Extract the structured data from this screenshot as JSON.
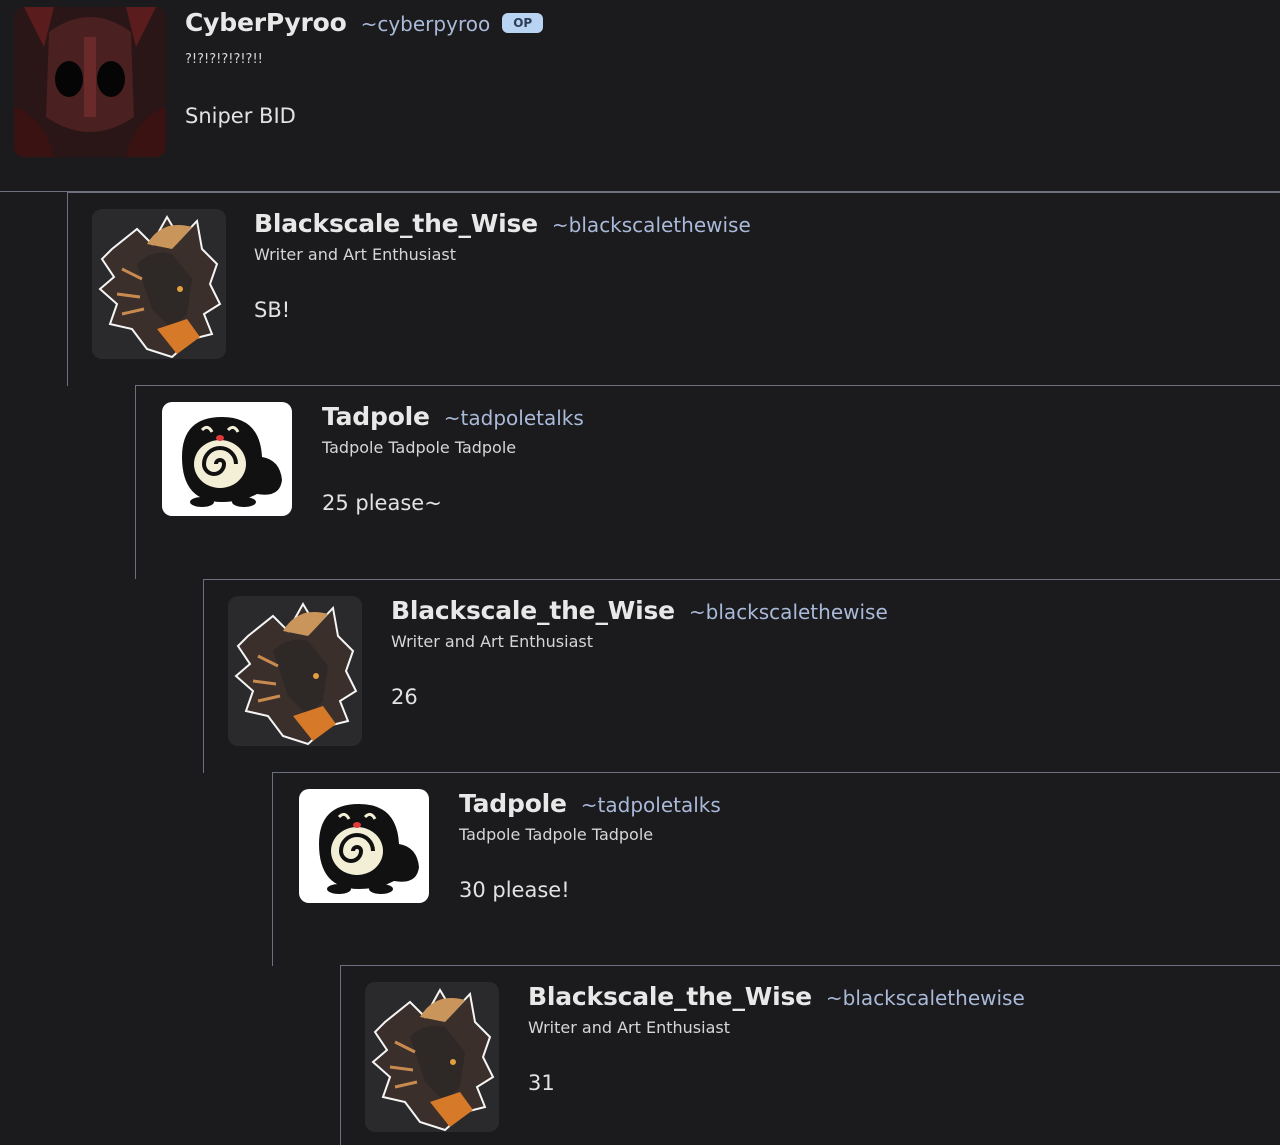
{
  "comments": [
    {
      "display_name": "CyberPyroo",
      "username": "~cyberpyroo",
      "badge": "OP",
      "tagline": "?!?!?!?!?!?!!",
      "body": "Sniper BID",
      "avatar": "masked-figure-avatar"
    },
    {
      "display_name": "Blackscale_the_Wise",
      "username": "~blackscalethewise",
      "tagline": "Writer and Art Enthusiast",
      "body": "SB!",
      "avatar": "dragon-avatar"
    },
    {
      "display_name": "Tadpole",
      "username": "~tadpoletalks",
      "tagline": "Tadpole Tadpole Tadpole",
      "body": "25 please~",
      "avatar": "tadpole-avatar"
    },
    {
      "display_name": "Blackscale_the_Wise",
      "username": "~blackscalethewise",
      "tagline": "Writer and Art Enthusiast",
      "body": "26",
      "avatar": "dragon-avatar"
    },
    {
      "display_name": "Tadpole",
      "username": "~tadpoletalks",
      "tagline": "Tadpole Tadpole Tadpole",
      "body": "30 please!",
      "avatar": "tadpole-avatar"
    },
    {
      "display_name": "Blackscale_the_Wise",
      "username": "~blackscalethewise",
      "tagline": "Writer and Art Enthusiast",
      "body": "31",
      "avatar": "dragon-avatar"
    }
  ],
  "colors": {
    "background": "#1b1b1e",
    "thread_line": "#6b6f80",
    "username": "#a9b9d8",
    "op_badge": "#b9d3f2"
  }
}
